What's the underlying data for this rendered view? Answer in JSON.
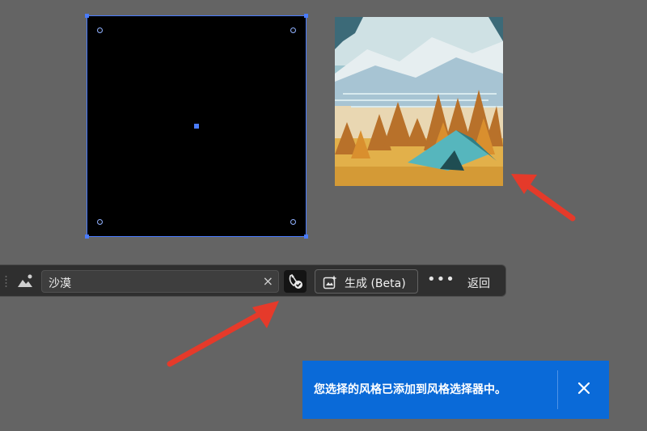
{
  "toolbar": {
    "prompt_value": "沙漠",
    "clear_glyph": "×",
    "generate_label": "生成 (Beta)",
    "more_glyph": "•••",
    "back_label": "返回",
    "icons": [
      "grip-handle-icon",
      "style-reference-icon",
      "clear-icon",
      "style-picker-icon",
      "generate-sparkle-icon",
      "more-icon"
    ]
  },
  "toast": {
    "message": "您选择的风格已添加到风格选择器中。",
    "close_icon": "close-icon"
  },
  "colors": {
    "canvas": "#646464",
    "selection": "#4a7cff",
    "toolbar": "#2f2f2f",
    "toast": "#0a6ad8",
    "arrow": "#e53a2a"
  }
}
